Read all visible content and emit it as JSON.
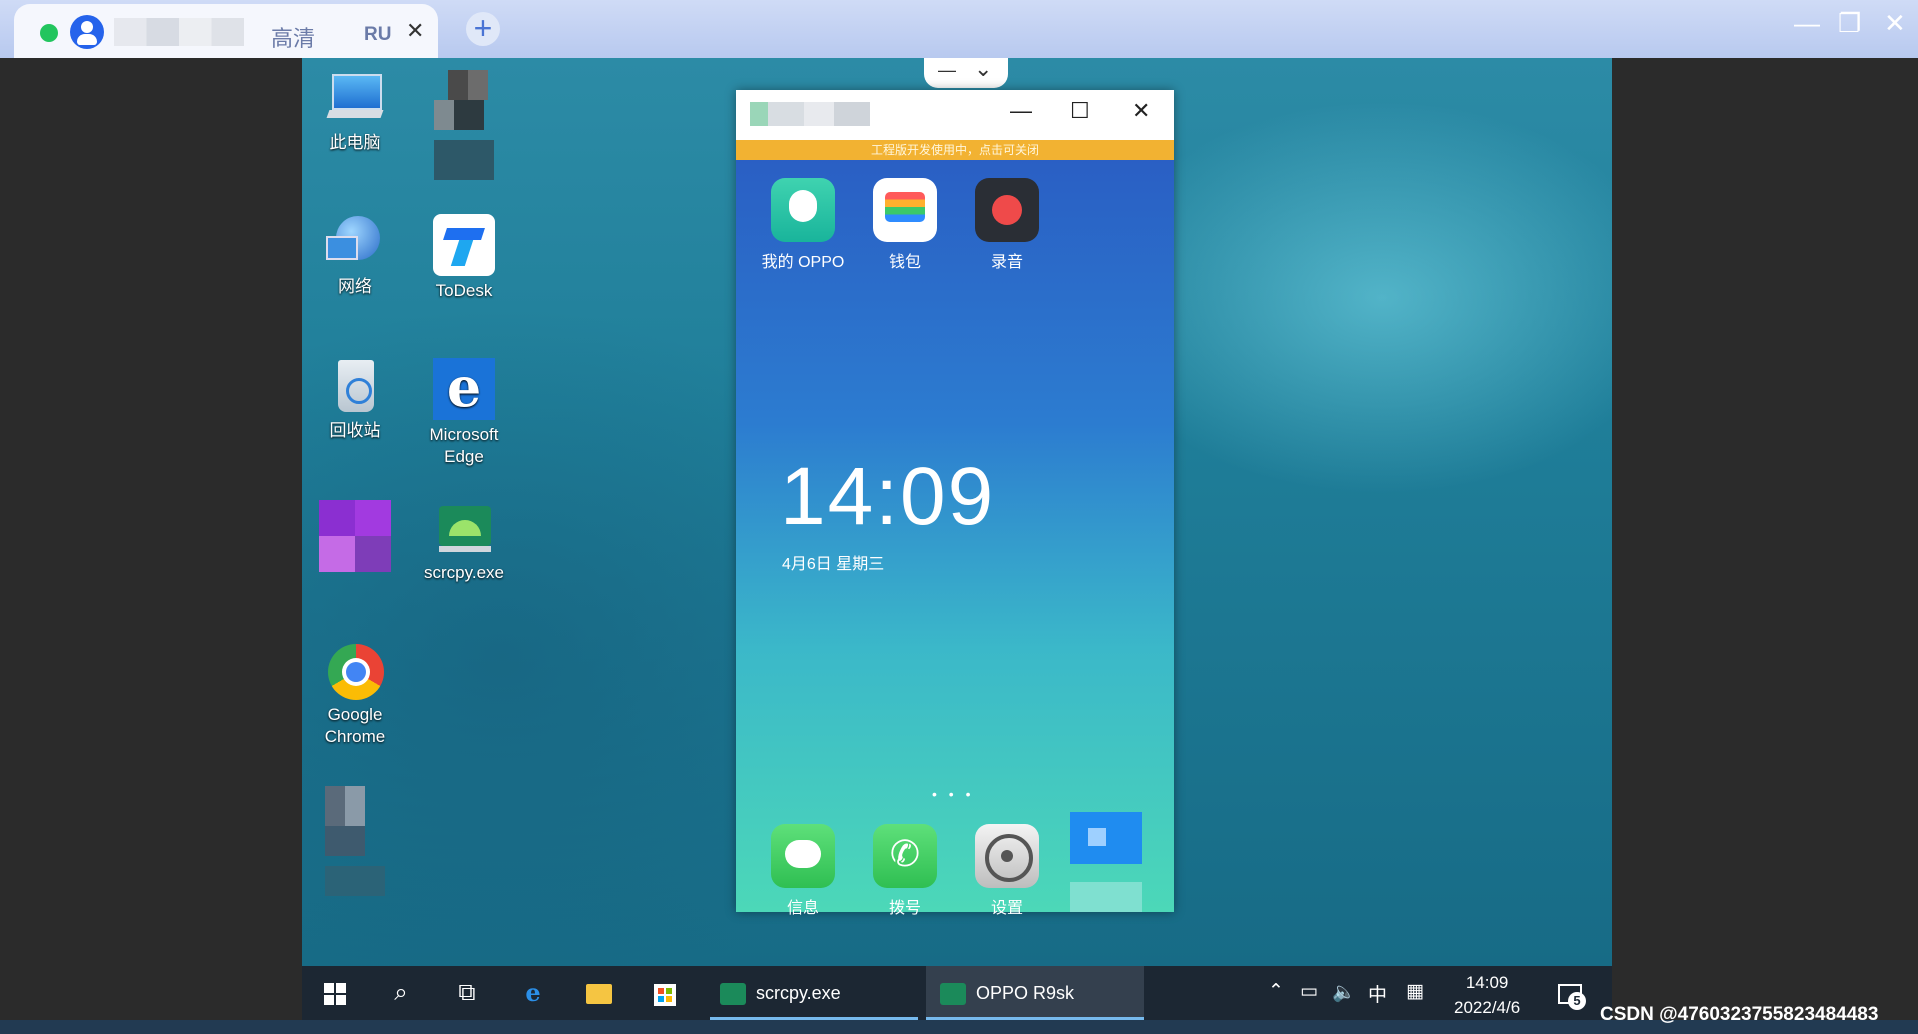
{
  "client": {
    "tab_title": "高清",
    "tab_lang": "RU",
    "tab_close": "✕",
    "new_tab": "+",
    "minimize": "—",
    "restore": "❐",
    "close": "✕"
  },
  "desktop": {
    "icons": [
      {
        "label": "此电脑"
      },
      {
        "label": "网络"
      },
      {
        "label": "ToDesk"
      },
      {
        "label": "回收站"
      },
      {
        "label": "Microsoft Edge"
      },
      {
        "label": "scrcpy.exe"
      },
      {
        "label": "Google Chrome"
      }
    ]
  },
  "phone_window": {
    "minimize": "—",
    "maximize": "☐",
    "close": "✕",
    "banner": "工程版开发使用中，点击可关闭",
    "top_apps": [
      {
        "label": "我的 OPPO"
      },
      {
        "label": "钱包"
      },
      {
        "label": "录音"
      }
    ],
    "clock": "14:09",
    "date": "4月6日  星期三",
    "dock_apps": [
      {
        "label": "信息"
      },
      {
        "label": "拨号"
      },
      {
        "label": "设置"
      }
    ],
    "mini_toolbar": {
      "minimize": "—",
      "collapse": "⌄"
    }
  },
  "taskbar": {
    "apps": [
      {
        "label": "scrcpy.exe"
      },
      {
        "label": "OPPO R9sk"
      }
    ],
    "ime": "中",
    "time": "14:09",
    "date": "2022/4/6",
    "notifications": "5"
  },
  "watermark": "CSDN @4760323755823484483"
}
